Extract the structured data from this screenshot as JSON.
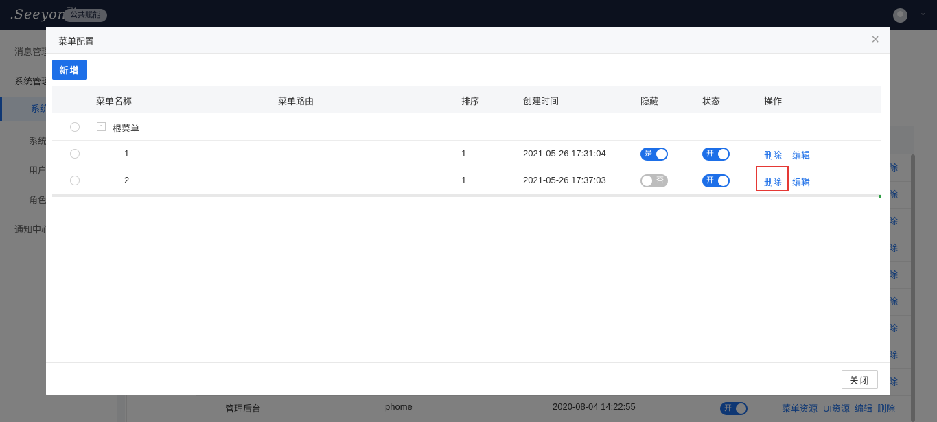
{
  "topbar": {
    "logo_text": ".Seeyon",
    "logo_tm": "TM",
    "badge": "公共赋能",
    "avatar_caret": "⌄"
  },
  "bg_sidebar": {
    "items": [
      {
        "label": "消息管理"
      },
      {
        "label": "系统管理"
      },
      {
        "label": "系统"
      },
      {
        "label": "系统"
      },
      {
        "label": "用户"
      },
      {
        "label": "角色"
      },
      {
        "label": "通知中心"
      }
    ]
  },
  "bg_table": {
    "link_fragment": "除",
    "partial_link_top": "除",
    "last_row": {
      "name": "管理后台",
      "route": "phome",
      "time": "2020-08-04 14:22:55",
      "status": "开",
      "links": [
        "菜单资源",
        "UI资源",
        "编辑",
        "删除"
      ]
    }
  },
  "modal": {
    "title": "菜单配置",
    "close_icon": "×",
    "add_button": "新增",
    "close_button": "关闭",
    "columns": [
      "菜单名称",
      "菜单路由",
      "排序",
      "创建时间",
      "隐藏",
      "状态",
      "操作"
    ],
    "root": {
      "expander": "-",
      "name": "根菜单"
    },
    "rows": [
      {
        "name": "1",
        "route": "",
        "sort": "1",
        "created": "2021-05-26 17:31:04",
        "hidden": "是",
        "hidden_on": true,
        "status": "开",
        "delete": "删除",
        "edit": "编辑"
      },
      {
        "name": "2",
        "route": "",
        "sort": "1",
        "created": "2021-05-26 17:37:03",
        "hidden": "否",
        "hidden_on": false,
        "status": "开",
        "delete": "删除",
        "edit": "编辑"
      }
    ]
  },
  "colors": {
    "primary": "#1d6fe8",
    "topbar": "#19233c",
    "highlight": "#e53935"
  }
}
